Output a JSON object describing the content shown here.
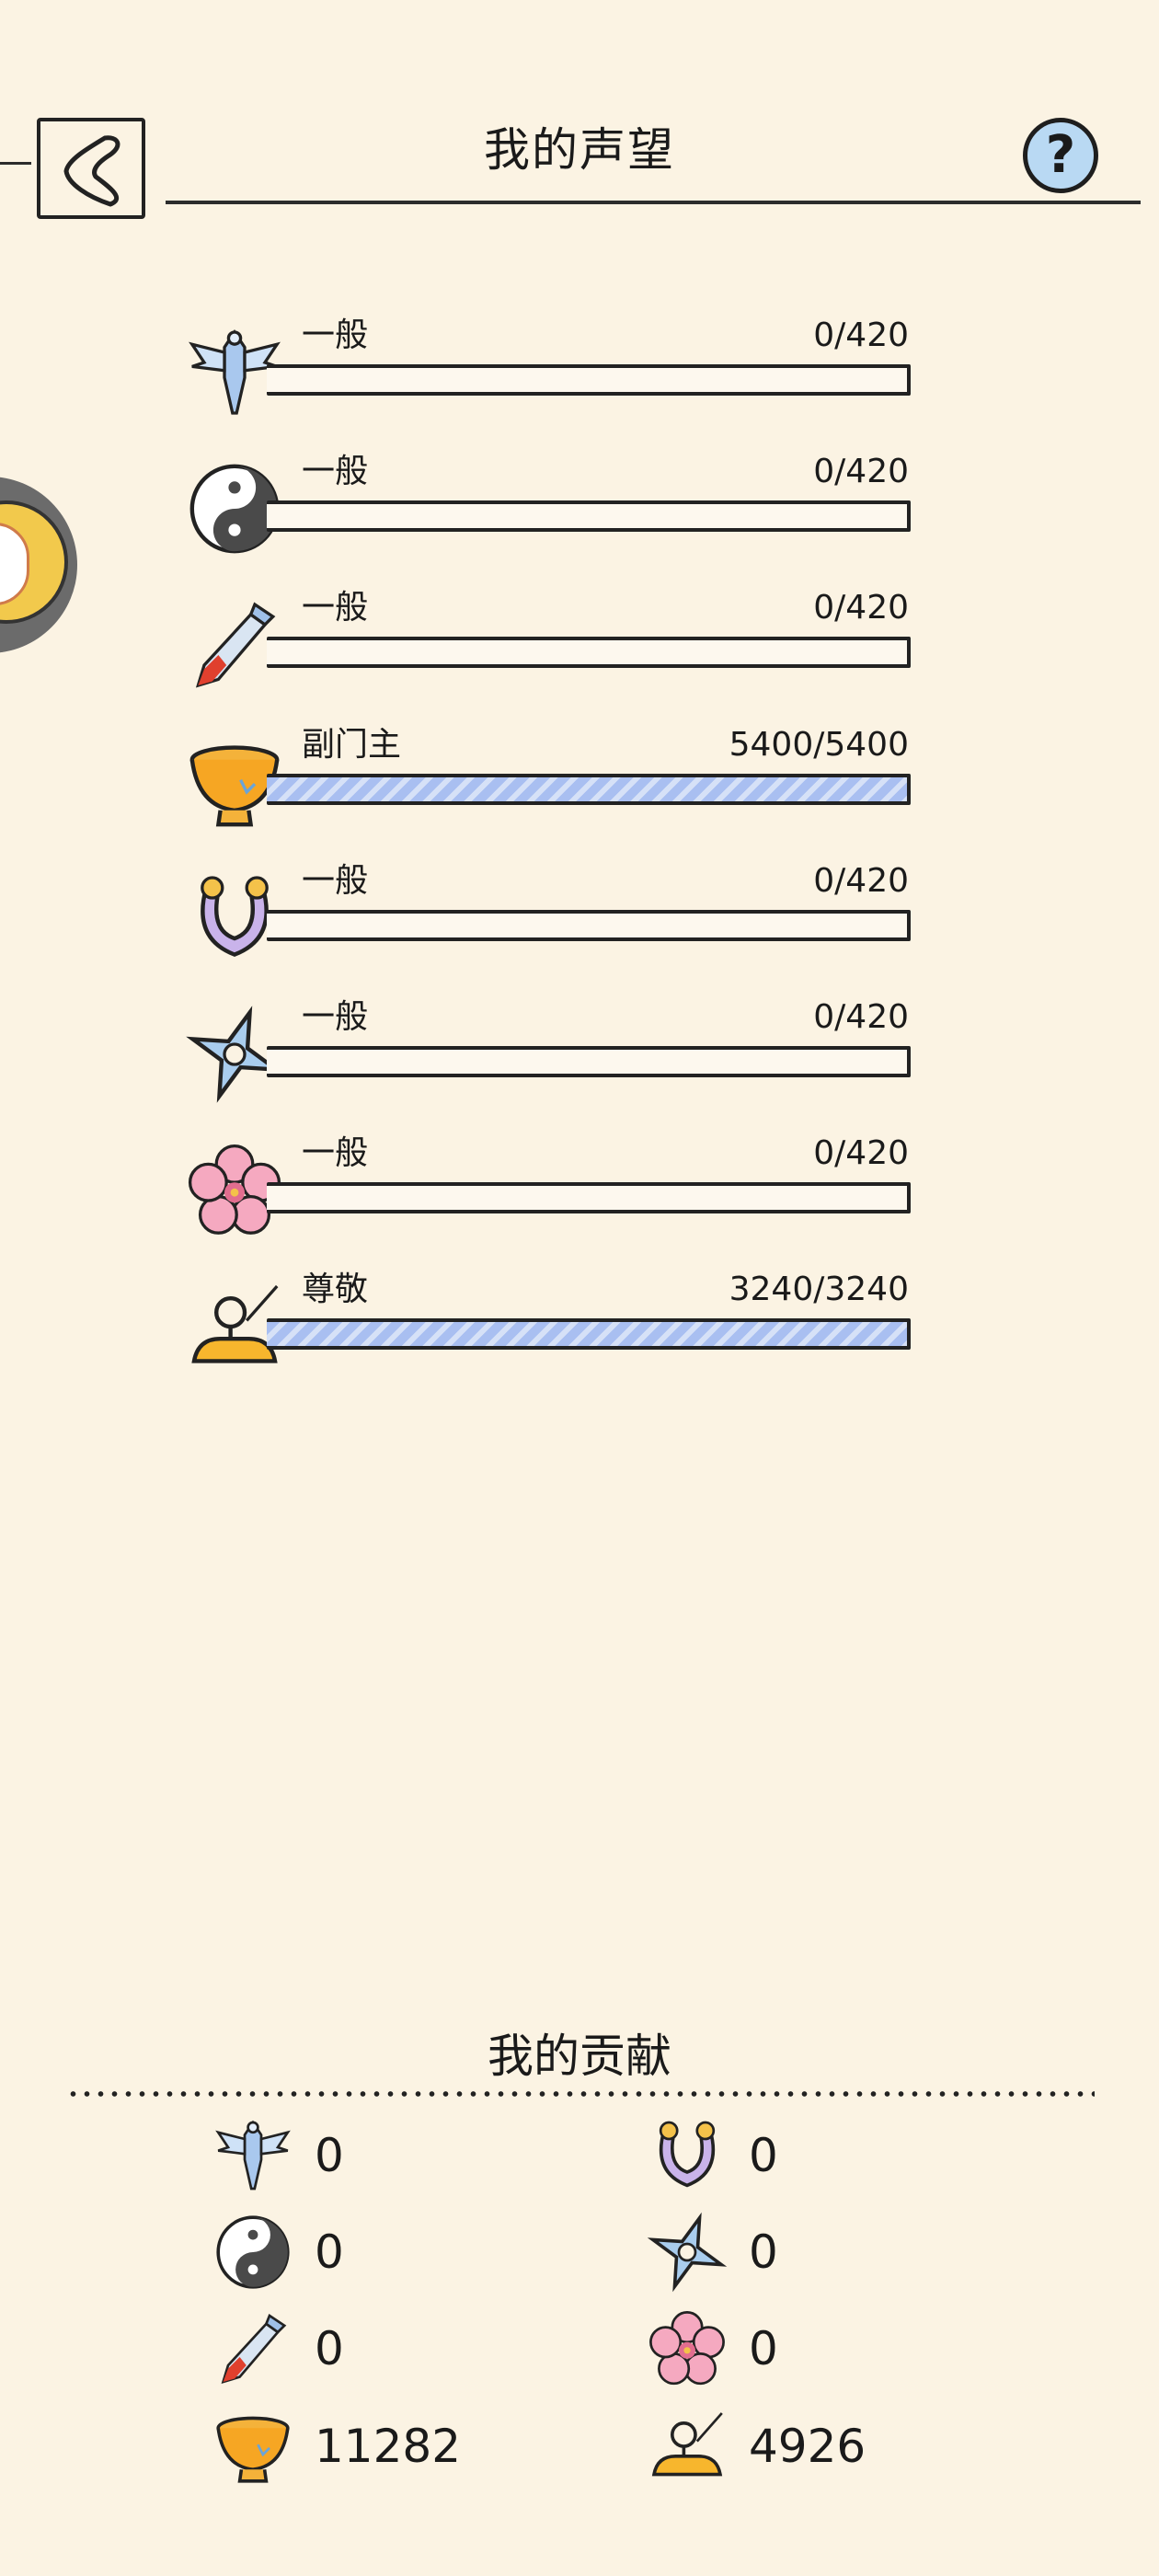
{
  "header": {
    "title": "我的声望",
    "help_label": "?"
  },
  "reputation": [
    {
      "icon": "winged-sword-icon",
      "rank": "一般",
      "current": 0,
      "max": 420,
      "value_text": "0/420",
      "fill": 0
    },
    {
      "icon": "yin-yang-icon",
      "rank": "一般",
      "current": 0,
      "max": 420,
      "value_text": "0/420",
      "fill": 0
    },
    {
      "icon": "bloody-dagger-icon",
      "rank": "一般",
      "current": 0,
      "max": 420,
      "value_text": "0/420",
      "fill": 0
    },
    {
      "icon": "golden-bowl-icon",
      "rank": "副门主",
      "current": 5400,
      "max": 5400,
      "value_text": "5400/5400",
      "fill": 1
    },
    {
      "icon": "horseshoe-snake-icon",
      "rank": "一般",
      "current": 0,
      "max": 420,
      "value_text": "0/420",
      "fill": 0
    },
    {
      "icon": "shuriken-icon",
      "rank": "一般",
      "current": 0,
      "max": 420,
      "value_text": "0/420",
      "fill": 0
    },
    {
      "icon": "cherry-blossom-icon",
      "rank": "一般",
      "current": 0,
      "max": 420,
      "value_text": "0/420",
      "fill": 0
    },
    {
      "icon": "meditating-monk-icon",
      "rank": "尊敬",
      "current": 3240,
      "max": 3240,
      "value_text": "3240/3240",
      "fill": 1
    }
  ],
  "contribution": {
    "title": "我的贡献",
    "left": [
      {
        "icon": "winged-sword-icon",
        "value": "0"
      },
      {
        "icon": "yin-yang-icon",
        "value": "0"
      },
      {
        "icon": "bloody-dagger-icon",
        "value": "0"
      },
      {
        "icon": "golden-bowl-icon",
        "value": "11282"
      }
    ],
    "right": [
      {
        "icon": "horseshoe-snake-icon",
        "value": "0"
      },
      {
        "icon": "shuriken-icon",
        "value": "0"
      },
      {
        "icon": "cherry-blossom-icon",
        "value": "0"
      },
      {
        "icon": "meditating-monk-icon",
        "value": "4926"
      }
    ]
  },
  "colors": {
    "background": "#fbf3e3",
    "bar_fill": "#a9bff1",
    "help_button": "#b9d9f3"
  }
}
